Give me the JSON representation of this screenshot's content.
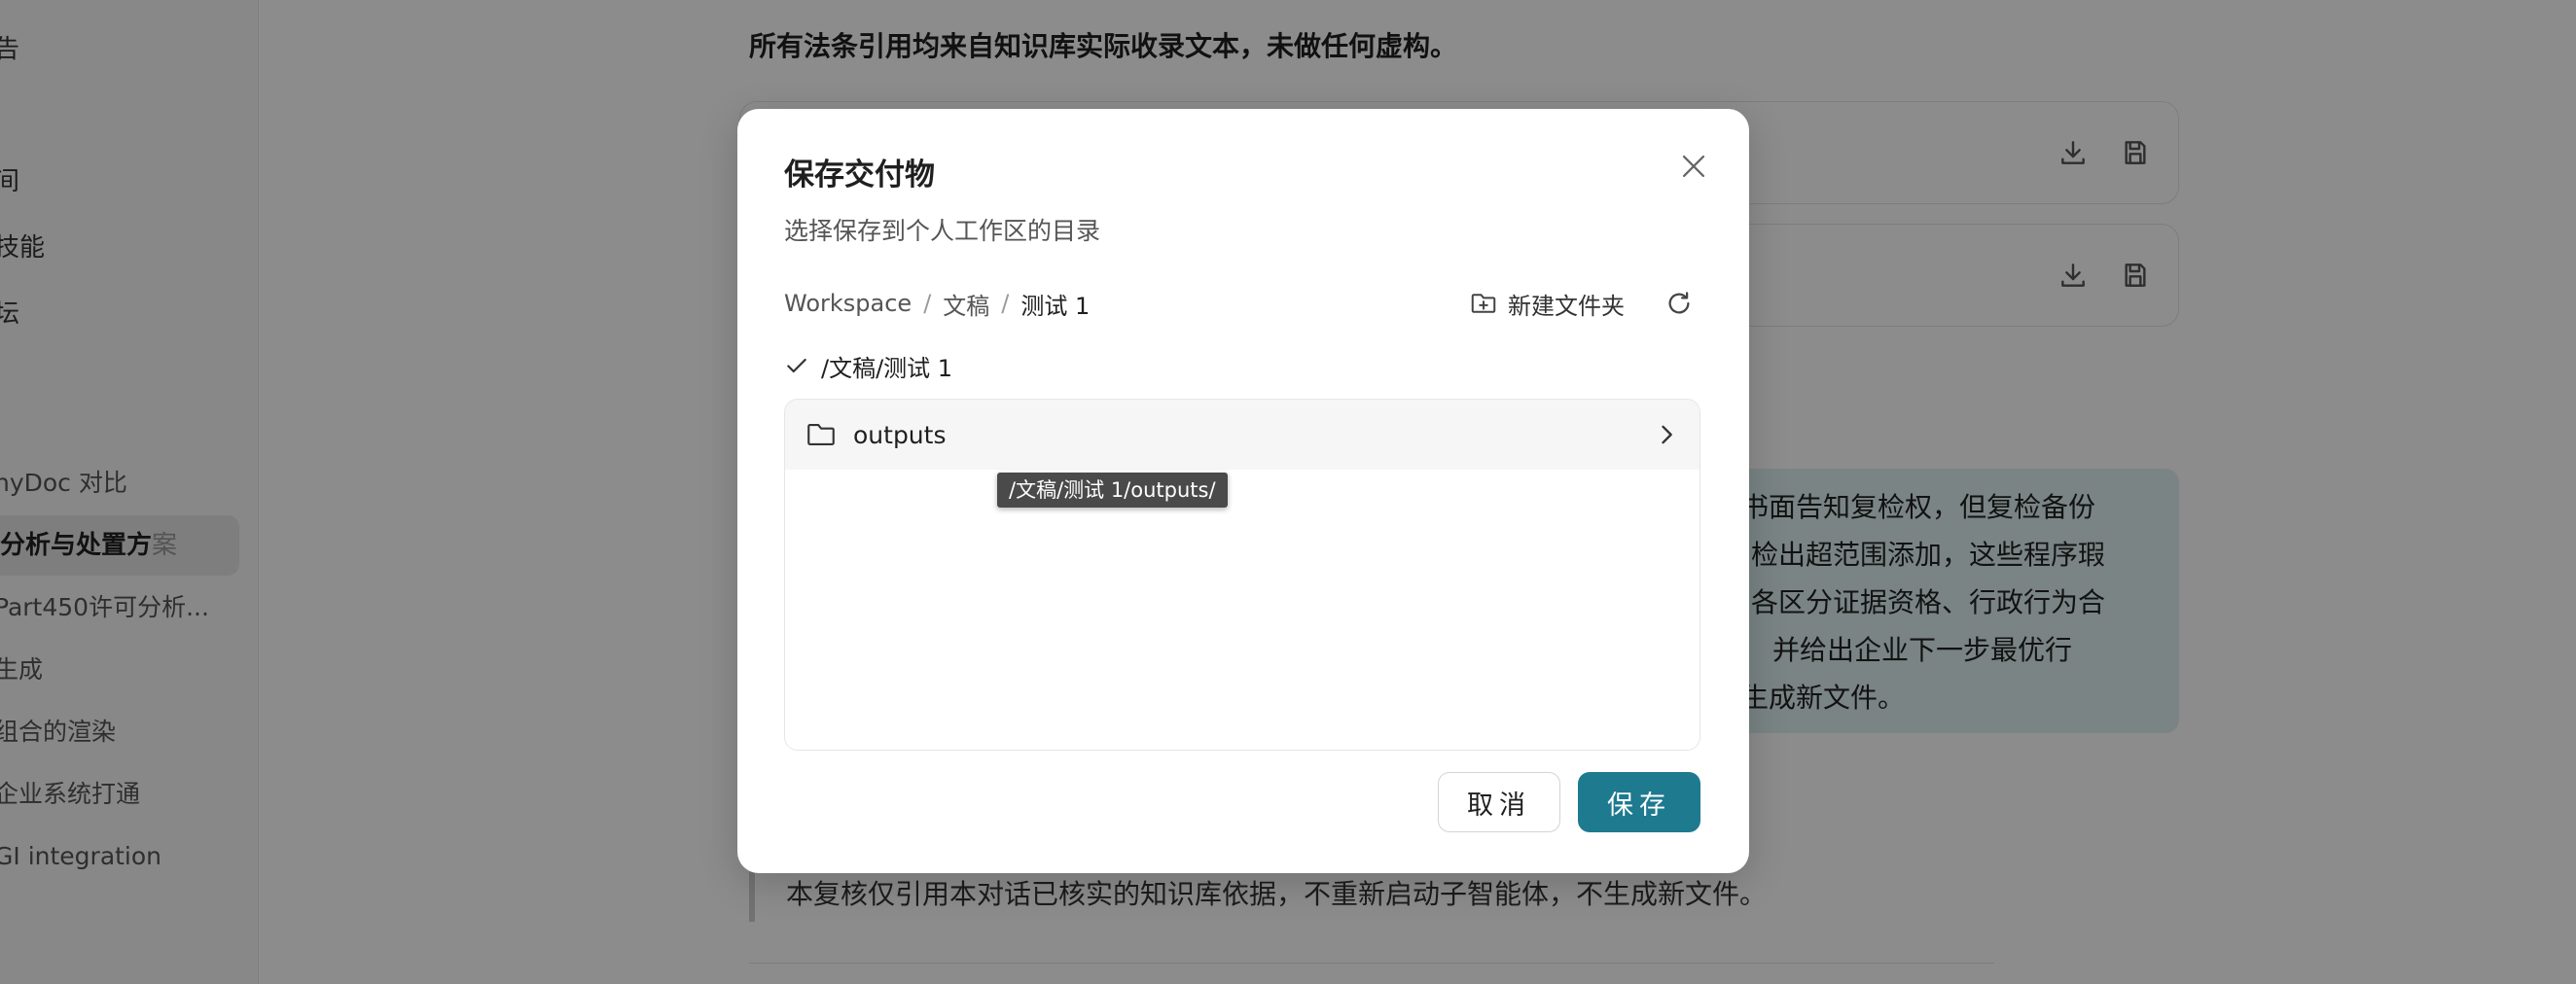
{
  "sidebar": {
    "top_items": [
      "告",
      "间",
      "技能",
      "坛"
    ],
    "conversations": [
      "nyDoc 对比",
      "分析与处置方案",
      "Part450许可分析...",
      "生成",
      "组合的渲染",
      "企业系统打通",
      "GI integration"
    ],
    "active_label_main": "分析与处置方",
    "active_label_fade": "案"
  },
  "main": {
    "top_text": "所有法条引用均来自知识库实际收录文本，未做任何虚构。",
    "teal_lines": [
      "书面告知复检权，但复检备份",
      "检出超范围添加，这些程序瑕",
      "各区分证据资格、行政行为合",
      "并给出企业下一步最优行",
      "生成新文件。"
    ],
    "quote_text": "本复核仅引用本对话已核实的知识库依据，不重新启动子智能体，不生成新文件。"
  },
  "dialog": {
    "title": "保存交付物",
    "subtitle": "选择保存到个人工作区的目录",
    "breadcrumb": [
      "Workspace",
      "文稿",
      "测试 1"
    ],
    "breadcrumb_sep": "/",
    "new_folder_label": "新建文件夹",
    "selected_path": "/文稿/测试 1",
    "folders": [
      {
        "name": "outputs"
      }
    ],
    "tooltip": "/文稿/测试 1/outputs/",
    "cancel_label": "取消",
    "save_label": "保存"
  },
  "colors": {
    "accent": "#1d7a8f",
    "overlay": "rgba(0,0,0,0.45)",
    "teal_box": "#dff0f1"
  },
  "icons": {
    "close": "close-icon",
    "new_folder": "folder-plus-icon",
    "refresh": "refresh-icon",
    "check": "check-icon",
    "folder": "folder-icon",
    "chevron": "chevron-right-icon",
    "download": "download-icon",
    "save": "save-icon"
  }
}
